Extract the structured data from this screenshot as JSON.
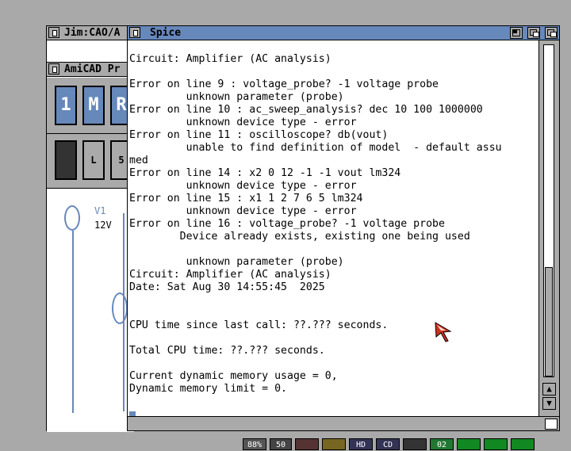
{
  "windows": {
    "jim": {
      "title": "Jim:CAO/A"
    },
    "amicad": {
      "title": "AmiCAD Pr"
    },
    "spice": {
      "title": "Spice"
    }
  },
  "amicad": {
    "toolbar1": [
      "1",
      "M",
      "R"
    ],
    "toolbar2": [
      "",
      "L",
      "5"
    ],
    "schematic": {
      "component": "V1",
      "value": "12V"
    }
  },
  "spice": {
    "lines": [
      "Circuit: Amplifier (AC analysis)",
      "",
      "Error on line 9 : voltage_probe? -1 voltage probe",
      "         unknown parameter (probe)",
      "Error on line 10 : ac_sweep_analysis? dec 10 100 1000000",
      "         unknown device type - error",
      "Error on line 11 : oscilloscope? db(vout)",
      "         unable to find definition of model  - default assu",
      "med",
      "Error on line 14 : x2 0 12 -1 -1 vout lm324",
      "         unknown device type - error",
      "Error on line 15 : x1 1 2 7 6 5 lm324",
      "         unknown device type - error",
      "Error on line 16 : voltage_probe? -1 voltage probe",
      "        Device already exists, existing one being used",
      "",
      "         unknown parameter (probe)",
      "Circuit: Amplifier (AC analysis)",
      "Date: Sat Aug 30 14:55:45  2025",
      "",
      "",
      "CPU time since last call: ??.??? seconds.",
      "",
      "Total CPU time: ??.??? seconds.",
      "",
      "Current dynamic memory usage = 0,",
      "Dynamic memory limit = 0."
    ]
  },
  "statusbar": {
    "items": [
      {
        "label": "88%",
        "color": "#555555"
      },
      {
        "label": "50",
        "color": "#444444"
      },
      {
        "label": "",
        "color": "#553333"
      },
      {
        "label": "",
        "color": "#776622"
      },
      {
        "label": "HD",
        "color": "#333355"
      },
      {
        "label": "CD",
        "color": "#333355"
      },
      {
        "label": "",
        "color": "#333333"
      },
      {
        "label": "02",
        "color": "#227733"
      },
      {
        "label": "",
        "color": "#118822"
      },
      {
        "label": "",
        "color": "#118822"
      },
      {
        "label": "",
        "color": "#118822"
      }
    ]
  }
}
